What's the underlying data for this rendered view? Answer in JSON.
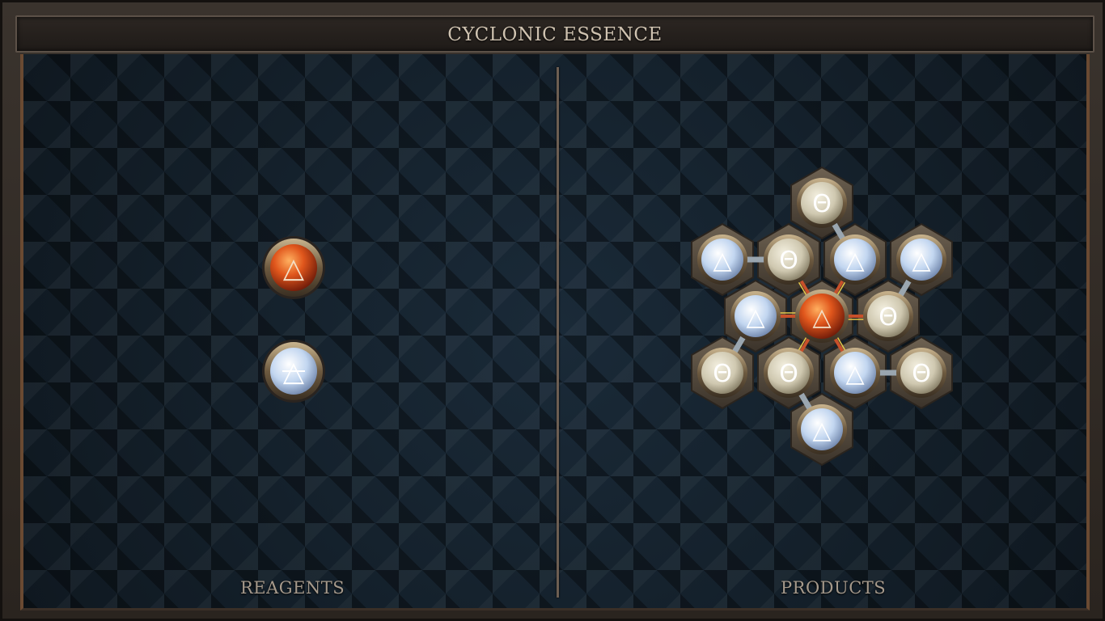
{
  "title": "CYCLONIC ESSENCE",
  "panels": {
    "reagents_label": "REAGENTS",
    "products_label": "PRODUCTS"
  },
  "reagents": [
    {
      "element": "fire",
      "symbol": "△"
    },
    {
      "element": "air",
      "symbol": "△"
    }
  ],
  "product_molecule": {
    "atoms": [
      {
        "element": "salt",
        "symbol": "Θ"
      },
      {
        "element": "air",
        "symbol": "△"
      },
      {
        "element": "salt",
        "symbol": "Θ"
      },
      {
        "element": "air",
        "symbol": "△"
      },
      {
        "element": "air",
        "symbol": "△"
      },
      {
        "element": "air",
        "symbol": "△"
      },
      {
        "element": "fire",
        "symbol": "△"
      },
      {
        "element": "salt",
        "symbol": "Θ"
      },
      {
        "element": "salt",
        "symbol": "Θ"
      },
      {
        "element": "salt",
        "symbol": "Θ"
      },
      {
        "element": "air",
        "symbol": "△"
      },
      {
        "element": "salt",
        "symbol": "Θ"
      },
      {
        "element": "air",
        "symbol": "△"
      }
    ]
  },
  "colors": {
    "fire": "#d8501a",
    "air": "#cfe0f4",
    "salt": "#d8d2bc",
    "title_text": "#cfc2b0",
    "label_text": "#a69a8c"
  }
}
